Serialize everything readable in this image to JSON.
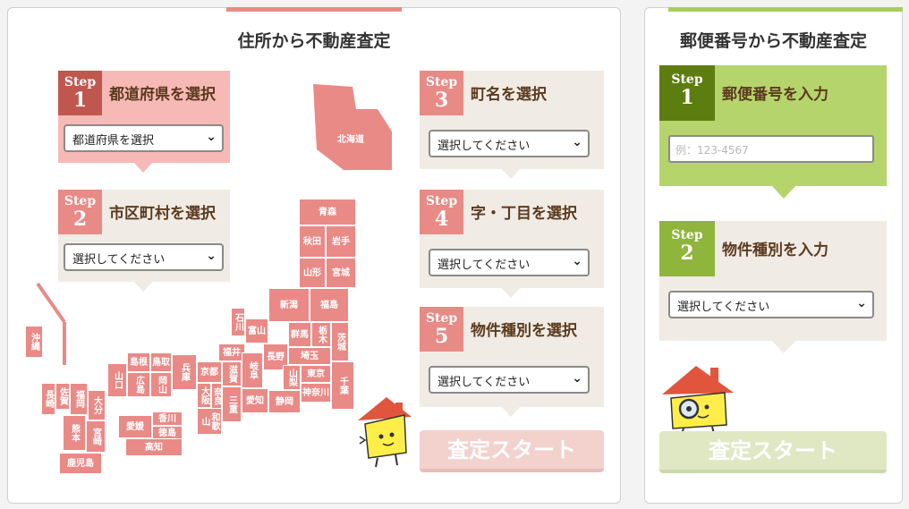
{
  "address_section": {
    "title": "住所から不動産査定",
    "steps": [
      {
        "word": "Step",
        "num": "1",
        "label": "都道府県を選択",
        "select": "都道府県を選択"
      },
      {
        "word": "Step",
        "num": "2",
        "label": "市区町村を選択",
        "select": "選択してください"
      },
      {
        "word": "Step",
        "num": "3",
        "label": "町名を選択",
        "select": "選択してください"
      },
      {
        "word": "Step",
        "num": "4",
        "label": "字・丁目を選択",
        "select": "選択してください"
      },
      {
        "word": "Step",
        "num": "5",
        "label": "物件種別を選択",
        "select": "選択してください"
      }
    ],
    "start_label": "査定スタート"
  },
  "map": {
    "prefectures": [
      "北海道",
      "青森",
      "秋田",
      "岩手",
      "山形",
      "宮城",
      "新潟",
      "福島",
      "石川",
      "富山",
      "群馬",
      "栃木",
      "茨城",
      "福井",
      "長野",
      "埼玉",
      "山梨",
      "東京",
      "千葉",
      "神奈川",
      "静岡",
      "岐阜",
      "愛知",
      "滋賀",
      "京都",
      "兵庫",
      "三重",
      "大阪",
      "奈良",
      "和歌山",
      "鳥取",
      "島根",
      "岡山",
      "広島",
      "山口",
      "香川",
      "愛媛",
      "徳島",
      "高知",
      "福岡",
      "佐賀",
      "長崎",
      "大分",
      "熊本",
      "宮崎",
      "鹿児島",
      "沖縄"
    ]
  },
  "zip_section": {
    "title": "郵便番号から不動産査定",
    "steps": [
      {
        "word": "Step",
        "num": "1",
        "label": "郵便番号を入力"
      },
      {
        "word": "Step",
        "num": "2",
        "label": "物件種別を入力",
        "select": "選択してください"
      }
    ],
    "zip_placeholder": "例：123-4567",
    "start_label": "査定スタート"
  },
  "colors": {
    "pink": "#e88a86",
    "dark_red": "#c0574e",
    "green": "#a9cd5c",
    "dark_green": "#5e7d10",
    "beige": "#f0ebe4"
  }
}
